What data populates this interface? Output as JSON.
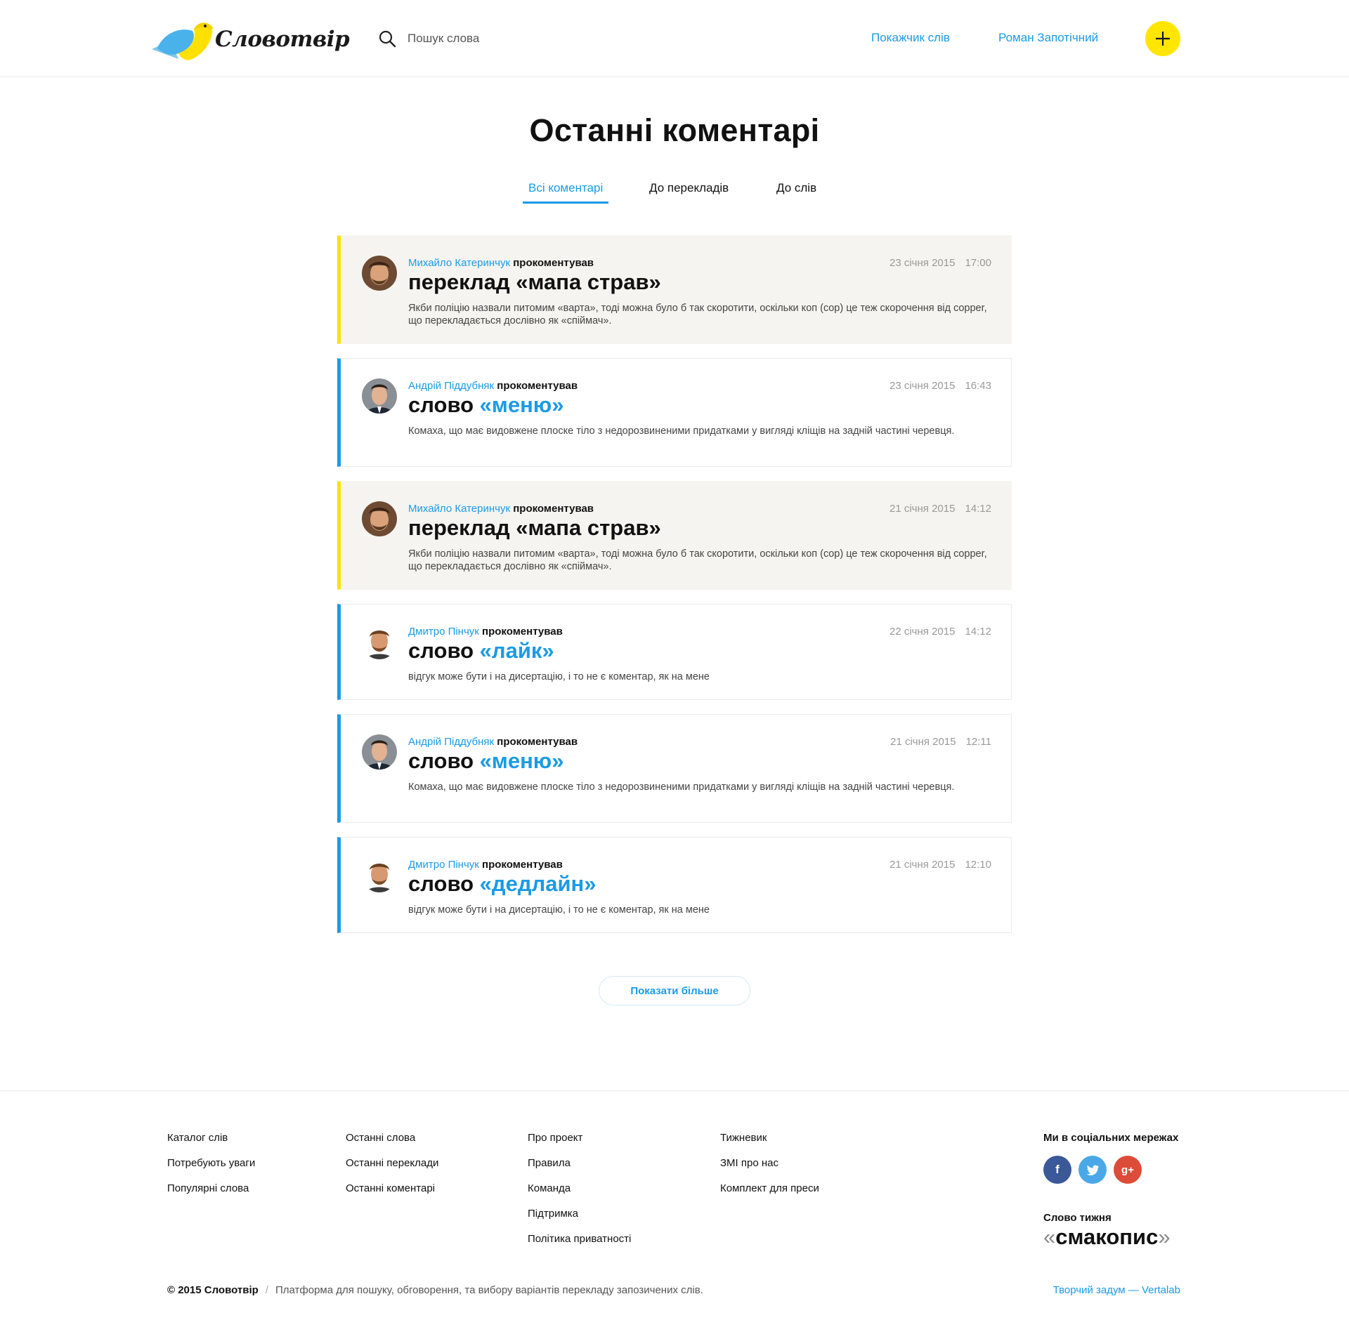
{
  "header": {
    "brand": "Словотвір",
    "search_placeholder": "Пошук слова",
    "nav_index": "Покажчик слів",
    "nav_user": "Роман Запотічний"
  },
  "page_title": "Останні коментарі",
  "tabs": [
    {
      "label": "Всі коментарі",
      "active": true
    },
    {
      "label": "До перекладів",
      "active": false
    },
    {
      "label": "До слів",
      "active": false
    }
  ],
  "comments": [
    {
      "type": "translation",
      "author": "Михайло Катеринчук",
      "action": "прокоментував",
      "prefix": "переклад «мапа страв»",
      "word": "",
      "date": "23 січня 2015",
      "time": "17:00",
      "text": "Якби поліцію назвали питомим «варта», тоді можна було б так скоротити, оскільки коп (cop) це теж скорочення від copper, що перекладається дослівно як «спіймач»."
    },
    {
      "type": "word",
      "author": "Андрій Піддубняк",
      "action": "прокоментував",
      "prefix": "слово ",
      "word": "«меню»",
      "date": "23 січня 2015",
      "time": "16:43",
      "text": "Комаха, що має видовжене плоске тіло з недорозвиненими придатками у вигляді кліщів на задній частині черевця."
    },
    {
      "type": "translation",
      "author": "Михайло Катеринчук",
      "action": "прокоментував",
      "prefix": "переклад «мапа страв»",
      "word": "",
      "date": "21 січня 2015",
      "time": "14:12",
      "text": "Якби поліцію назвали питомим «варта», тоді можна було б так скоротити, оскільки коп (cop) це теж скорочення від copper, що перекладається дослівно як «спіймач»."
    },
    {
      "type": "word",
      "author": "Дмитро Пінчук",
      "action": "прокоментував",
      "prefix": "слово ",
      "word": "«лайк»",
      "date": "22 січня 2015",
      "time": "14:12",
      "text": "відгук може бути і на дисертацію, і то не є коментар, як на мене"
    },
    {
      "type": "word",
      "author": "Андрій Піддубняк",
      "action": "прокоментував",
      "prefix": "слово ",
      "word": "«меню»",
      "date": "21 січня 2015",
      "time": "12:11",
      "text": "Комаха, що має видовжене плоске тіло з недорозвиненими придатками у вигляді кліщів на задній частині черевця."
    },
    {
      "type": "word",
      "author": "Дмитро Пінчук",
      "action": "прокоментував",
      "prefix": "слово ",
      "word": "«дедлайн»",
      "date": "21 січня 2015",
      "time": "12:10",
      "text": "відгук може бути і на дисертацію, і то не є коментар, як на мене"
    }
  ],
  "more_button": "Показати більше",
  "footer": {
    "col1": [
      "Каталог слів",
      "Потребують уваги",
      "Популярні слова"
    ],
    "col2": [
      "Останні слова",
      "Останні переклади",
      "Останні коментарі"
    ],
    "col3": [
      "Про проект",
      "Правила",
      "Команда",
      "Підтримка",
      "Політика приватності"
    ],
    "col4": [
      "Тижневик",
      "ЗМІ про нас",
      "Комплект для преси"
    ],
    "social_title": "Ми в соціальних мережах",
    "word_of_week_label": "Слово тижня",
    "word_of_week": "смакопис",
    "copyright": "© 2015 Словотвір",
    "separator": "/",
    "description": "Платформа для пошуку, обговорення, та вибору варіантів перекладу запозичених слів.",
    "credit": "Творчий задум — Vertalab"
  },
  "colors": {
    "accent": "#1a9be6",
    "yellow": "#ffe600",
    "card_translation_bg": "#f5f4f0"
  }
}
